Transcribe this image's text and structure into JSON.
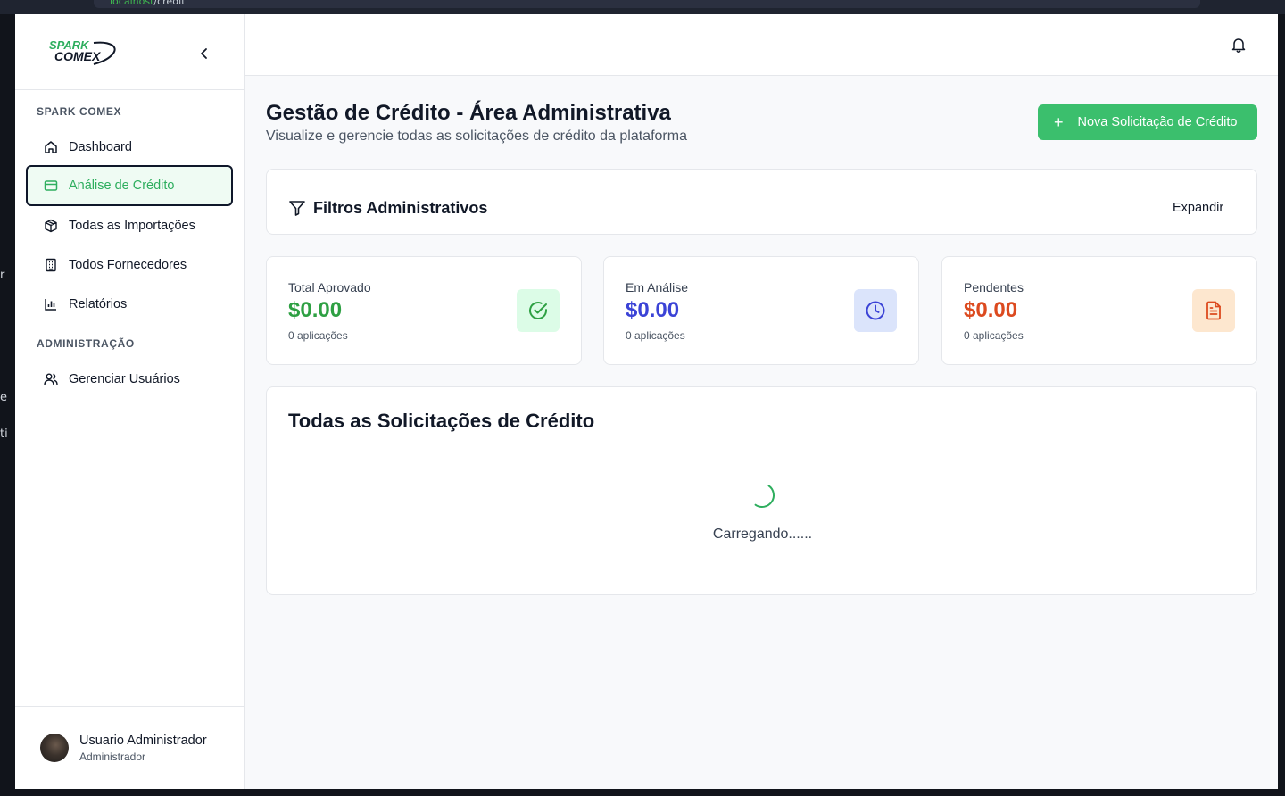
{
  "browser": {
    "url_host": "localhost",
    "url_path": "/credit",
    "left_edge_glyphs": [
      "r",
      "e",
      "ti"
    ]
  },
  "brand": {
    "logo_top": "SPARK",
    "logo_bottom": "COMEX",
    "accent": "#3bbf6d"
  },
  "sidebar": {
    "section_main": "SPARK COMEX",
    "items": [
      {
        "label": "Dashboard",
        "icon": "home-icon"
      },
      {
        "label": "Análise de Crédito",
        "icon": "credit-card-icon",
        "active": true
      },
      {
        "label": "Todas as Importações",
        "icon": "package-icon"
      },
      {
        "label": "Todos Fornecedores",
        "icon": "building-icon"
      },
      {
        "label": "Relatórios",
        "icon": "bar-chart-icon"
      }
    ],
    "section_admin": "ADMINISTRAÇÃO",
    "admin_items": [
      {
        "label": "Gerenciar Usuários",
        "icon": "users-icon"
      }
    ],
    "user": {
      "name": "Usuario Administrador",
      "role": "Administrador"
    }
  },
  "header": {
    "title": "Gestão de Crédito - Área Administrativa",
    "subtitle": "Visualize e gerencie todas as solicitações de crédito da plataforma",
    "new_button": "Nova Solicitação de Crédito"
  },
  "filters": {
    "title": "Filtros Administrativos",
    "expand_label": "Expandir"
  },
  "stats": [
    {
      "label": "Total Aprovado",
      "value": "$0.00",
      "count": "0 aplicações",
      "color": "#2ea043",
      "bg": "#dcfce7",
      "icon": "check-circle-icon"
    },
    {
      "label": "Em Análise",
      "value": "$0.00",
      "count": "0 aplicações",
      "color": "#3b43d6",
      "bg": "#dbe4fb",
      "icon": "clock-icon"
    },
    {
      "label": "Pendentes",
      "value": "$0.00",
      "count": "0 aplicações",
      "color": "#dc4a1f",
      "bg": "#fde7cf",
      "icon": "document-icon"
    }
  ],
  "requests": {
    "title": "Todas as Solicitações de Crédito",
    "loading_text": "Carregando......"
  }
}
